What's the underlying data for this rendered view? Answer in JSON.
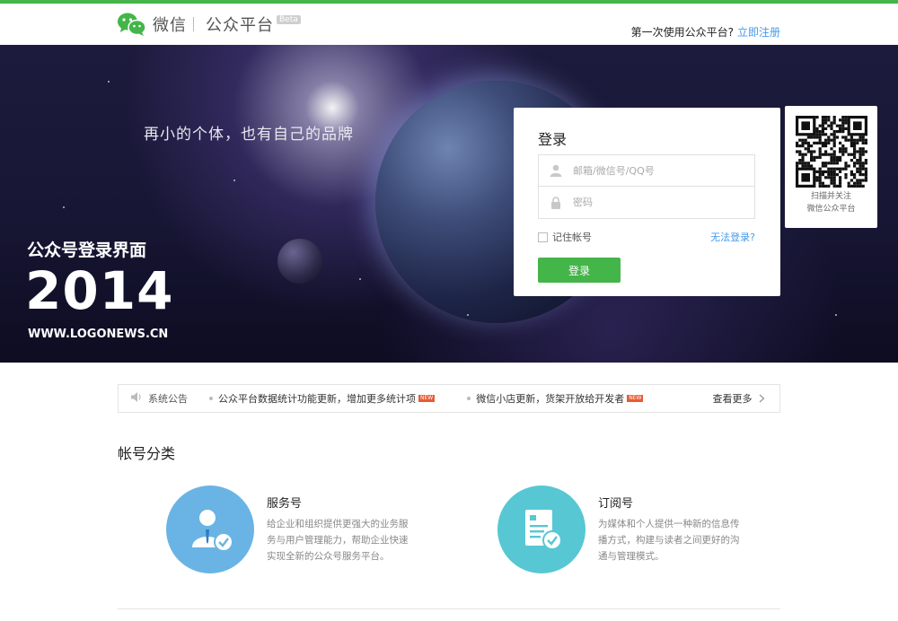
{
  "header": {
    "brand": "微信",
    "product": "公众平台",
    "beta": "Beta",
    "first_time_text": "第一次使用公众平台?",
    "register_link": "立即注册"
  },
  "hero": {
    "slogan": "再小的个体，也有自己的品牌",
    "watermark_title": "公众号登录界面",
    "watermark_year": "2014",
    "watermark_url": "WWW.LOGONEWS.CN"
  },
  "login": {
    "title": "登录",
    "account_placeholder": "邮箱/微信号/QQ号",
    "password_placeholder": "密码",
    "remember_label": "记住帐号",
    "forgot_link": "无法登录?",
    "submit_label": "登录"
  },
  "qr": {
    "caption_line1": "扫描并关注",
    "caption_line2": "微信公众平台"
  },
  "notice": {
    "label": "系统公告",
    "items": [
      {
        "text": "公众平台数据统计功能更新，增加更多统计项",
        "tag": "NEW"
      },
      {
        "text": "微信小店更新，货架开放给开发者",
        "tag": "NEW"
      }
    ],
    "more": "查看更多"
  },
  "accounts": {
    "title": "帐号分类",
    "items": [
      {
        "name": "服务号",
        "desc": "给企业和组织提供更强大的业务服务与用户管理能力，帮助企业快速实现全新的公众号服务平台。",
        "color": "#69b4e4"
      },
      {
        "name": "订阅号",
        "desc": "为媒体和个人提供一种新的信息传播方式，构建与读者之间更好的沟通与管理模式。",
        "color": "#57c7d3"
      }
    ]
  },
  "colors": {
    "brand_green": "#44b549",
    "link_blue": "#459ae9"
  }
}
